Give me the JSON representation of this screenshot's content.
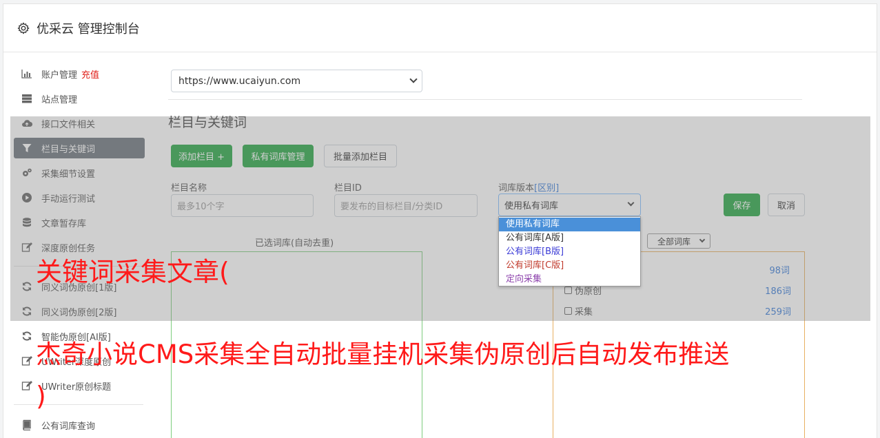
{
  "header": {
    "title": "优采云 管理控制台"
  },
  "sidebar": {
    "items": [
      {
        "label": "账户管理",
        "badge": "充值",
        "icon": "bar-chart-icon"
      },
      {
        "label": "站点管理",
        "icon": "server-icon"
      },
      {
        "label": "接口文件相关",
        "icon": "cloud-upload-icon"
      },
      {
        "label": "栏目与关键词",
        "icon": "filter-icon",
        "active": true
      },
      {
        "label": "采集细节设置",
        "icon": "gears-icon"
      },
      {
        "label": "手动运行测试",
        "icon": "play-circle-icon"
      },
      {
        "label": "文章暂存库",
        "icon": "database-icon"
      },
      {
        "label": "深度原创任务",
        "icon": "edit-icon"
      },
      {
        "label": "同义词伪原创[1版]",
        "icon": "refresh-icon"
      },
      {
        "label": "同义词伪原创[2版]",
        "icon": "refresh-icon"
      },
      {
        "label": "智能伪原创[AI版]",
        "icon": "refresh-icon"
      },
      {
        "label": "UWriter深度原创",
        "icon": "edit-icon"
      },
      {
        "label": "UWriter原创标题",
        "icon": "edit-icon"
      },
      {
        "label": "公有词库查询",
        "icon": "book-icon"
      }
    ]
  },
  "main": {
    "site_select": "https://www.ucaiyun.com",
    "section_title": "栏目与关键词",
    "buttons": {
      "add_column": "添加栏目 +",
      "private_lib": "私有词库管理",
      "batch_add": "批量添加栏目",
      "save": "保存",
      "cancel": "取消"
    },
    "form": {
      "name_label": "栏目名称",
      "name_placeholder": "最多10个字",
      "id_label": "栏目ID",
      "id_placeholder": "要发布的目标栏目/分类ID",
      "version_label": "词库版本",
      "version_link": "[区别]",
      "version_value": "使用私有词库"
    },
    "dropdown_options": [
      {
        "label": "使用私有词库",
        "color": "#ffffff",
        "highlight": true
      },
      {
        "label": "公有词库[A版]",
        "color": "#333333"
      },
      {
        "label": "公有词库[B版]",
        "color": "#3b3bd6"
      },
      {
        "label": "公有词库[C版]",
        "color": "#c0392b"
      },
      {
        "label": "定向采集",
        "color": "#8e44ad"
      }
    ],
    "selected_label": "已选词库(自动去重)",
    "all_libs": "全部词库",
    "libs": [
      {
        "label": "",
        "count": "98词"
      },
      {
        "label": "伪原创",
        "count": "186词"
      },
      {
        "label": "采集",
        "count": "259词"
      }
    ]
  },
  "overlay_text": {
    "line1": "关键词采集文章(",
    "line2": "杰奇小说CMS采集全自动批量挂机采集伪原创后自动发布推送",
    "line3": ")"
  }
}
